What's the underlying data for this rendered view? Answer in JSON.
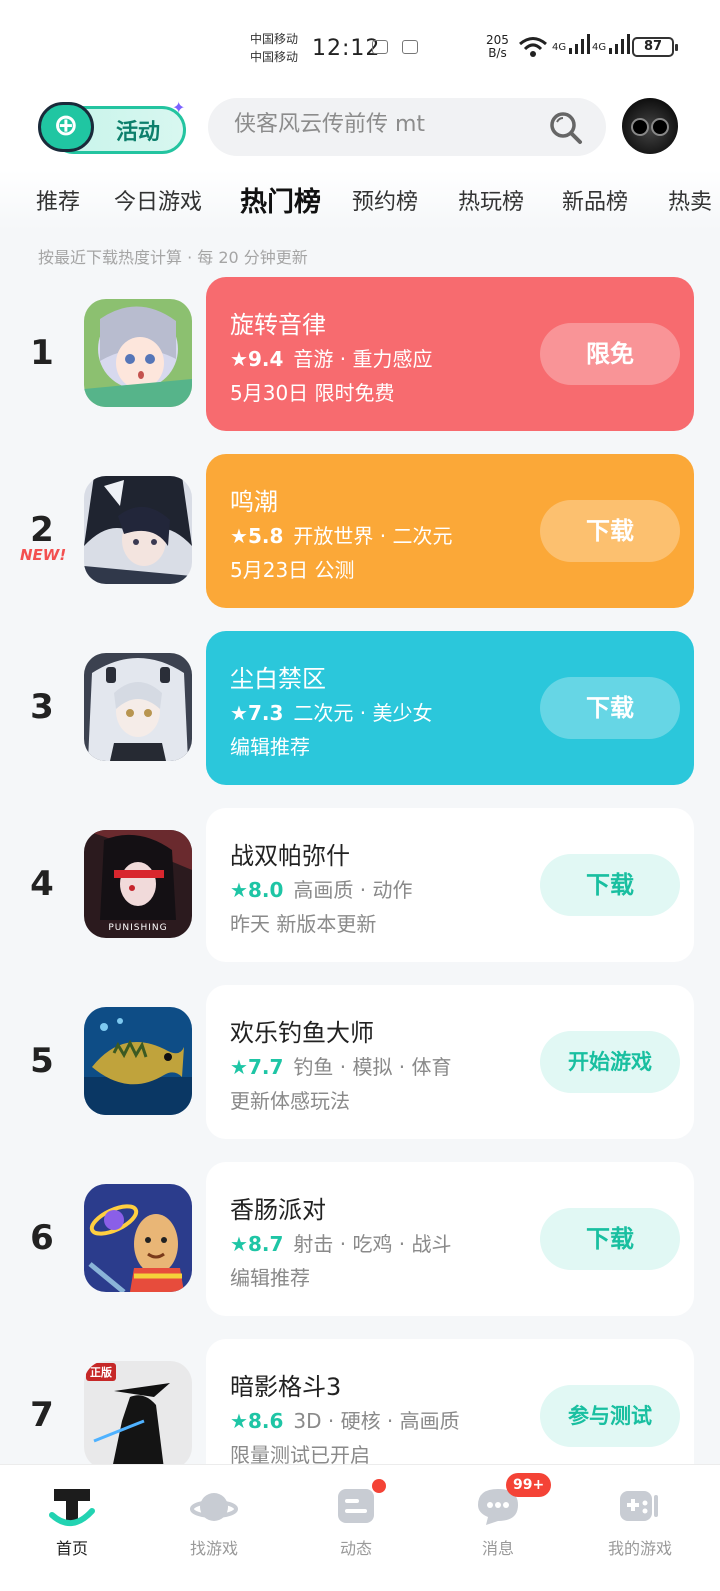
{
  "status_bar": {
    "carrier_1": "中国移动",
    "carrier_2": "中国移动",
    "time": "12:12",
    "net_speed_value": "205",
    "net_speed_unit": "B/s",
    "signal_1": "4G",
    "signal_2": "4G",
    "battery": "87"
  },
  "header": {
    "logo_text": "活动",
    "search_placeholder": "侠客风云传前传 mt"
  },
  "tabs": [
    "推荐",
    "今日游戏",
    "热门榜",
    "预约榜",
    "热玩榜",
    "新品榜",
    "热卖"
  ],
  "active_tab": "热门榜",
  "subtitle": "按最近下载热度计算 · 每 20 分钟更新",
  "games": [
    {
      "rank": "1",
      "name": "旋转音律",
      "score": "9.4",
      "tags": "音游 · 重力感应",
      "desc": "5月30日 限时免费",
      "action": "限免",
      "card_color": "#f76b6f"
    },
    {
      "rank": "2",
      "new_tag": "NEW!",
      "name": "鸣潮",
      "score": "5.8",
      "tags": "开放世界 · 二次元",
      "desc": "5月23日 公测",
      "action": "下载",
      "card_color": "#fba838"
    },
    {
      "rank": "3",
      "name": "尘白禁区",
      "score": "7.3",
      "tags": "二次元 · 美少女",
      "desc": "编辑推荐",
      "action": "下载",
      "card_color": "#2bc7db"
    },
    {
      "rank": "4",
      "name": "战双帕弥什",
      "score": "8.0",
      "tags": "高画质 · 动作",
      "desc": "昨天 新版本更新",
      "action": "下载",
      "icon_caption": "PUNISHING"
    },
    {
      "rank": "5",
      "name": "欢乐钓鱼大师",
      "score": "7.7",
      "tags": "钓鱼 · 模拟 · 体育",
      "desc": "更新体感玩法",
      "action": "开始游戏"
    },
    {
      "rank": "6",
      "name": "香肠派对",
      "score": "8.7",
      "tags": "射击 · 吃鸡 · 战斗",
      "desc": "编辑推荐",
      "action": "下载"
    },
    {
      "rank": "7",
      "name": "暗影格斗3",
      "score": "8.6",
      "tags": "3D · 硬核 · 高画质",
      "desc": "限量测试已开启",
      "action": "参与测试",
      "icon_caption": "正版"
    }
  ],
  "bottom_nav": [
    {
      "label": "首页",
      "icon": "home-icon",
      "active": true
    },
    {
      "label": "找游戏",
      "icon": "planet-icon"
    },
    {
      "label": "动态",
      "icon": "feed-icon",
      "dot": true
    },
    {
      "label": "消息",
      "icon": "message-icon",
      "badge": "99+"
    },
    {
      "label": "我的游戏",
      "icon": "gamepad-icon"
    }
  ],
  "colors": {
    "accent": "#1ec5a5",
    "rank1": "#f76b6f",
    "rank2": "#fba838",
    "rank3": "#2bc7db",
    "badge": "#f44336"
  }
}
